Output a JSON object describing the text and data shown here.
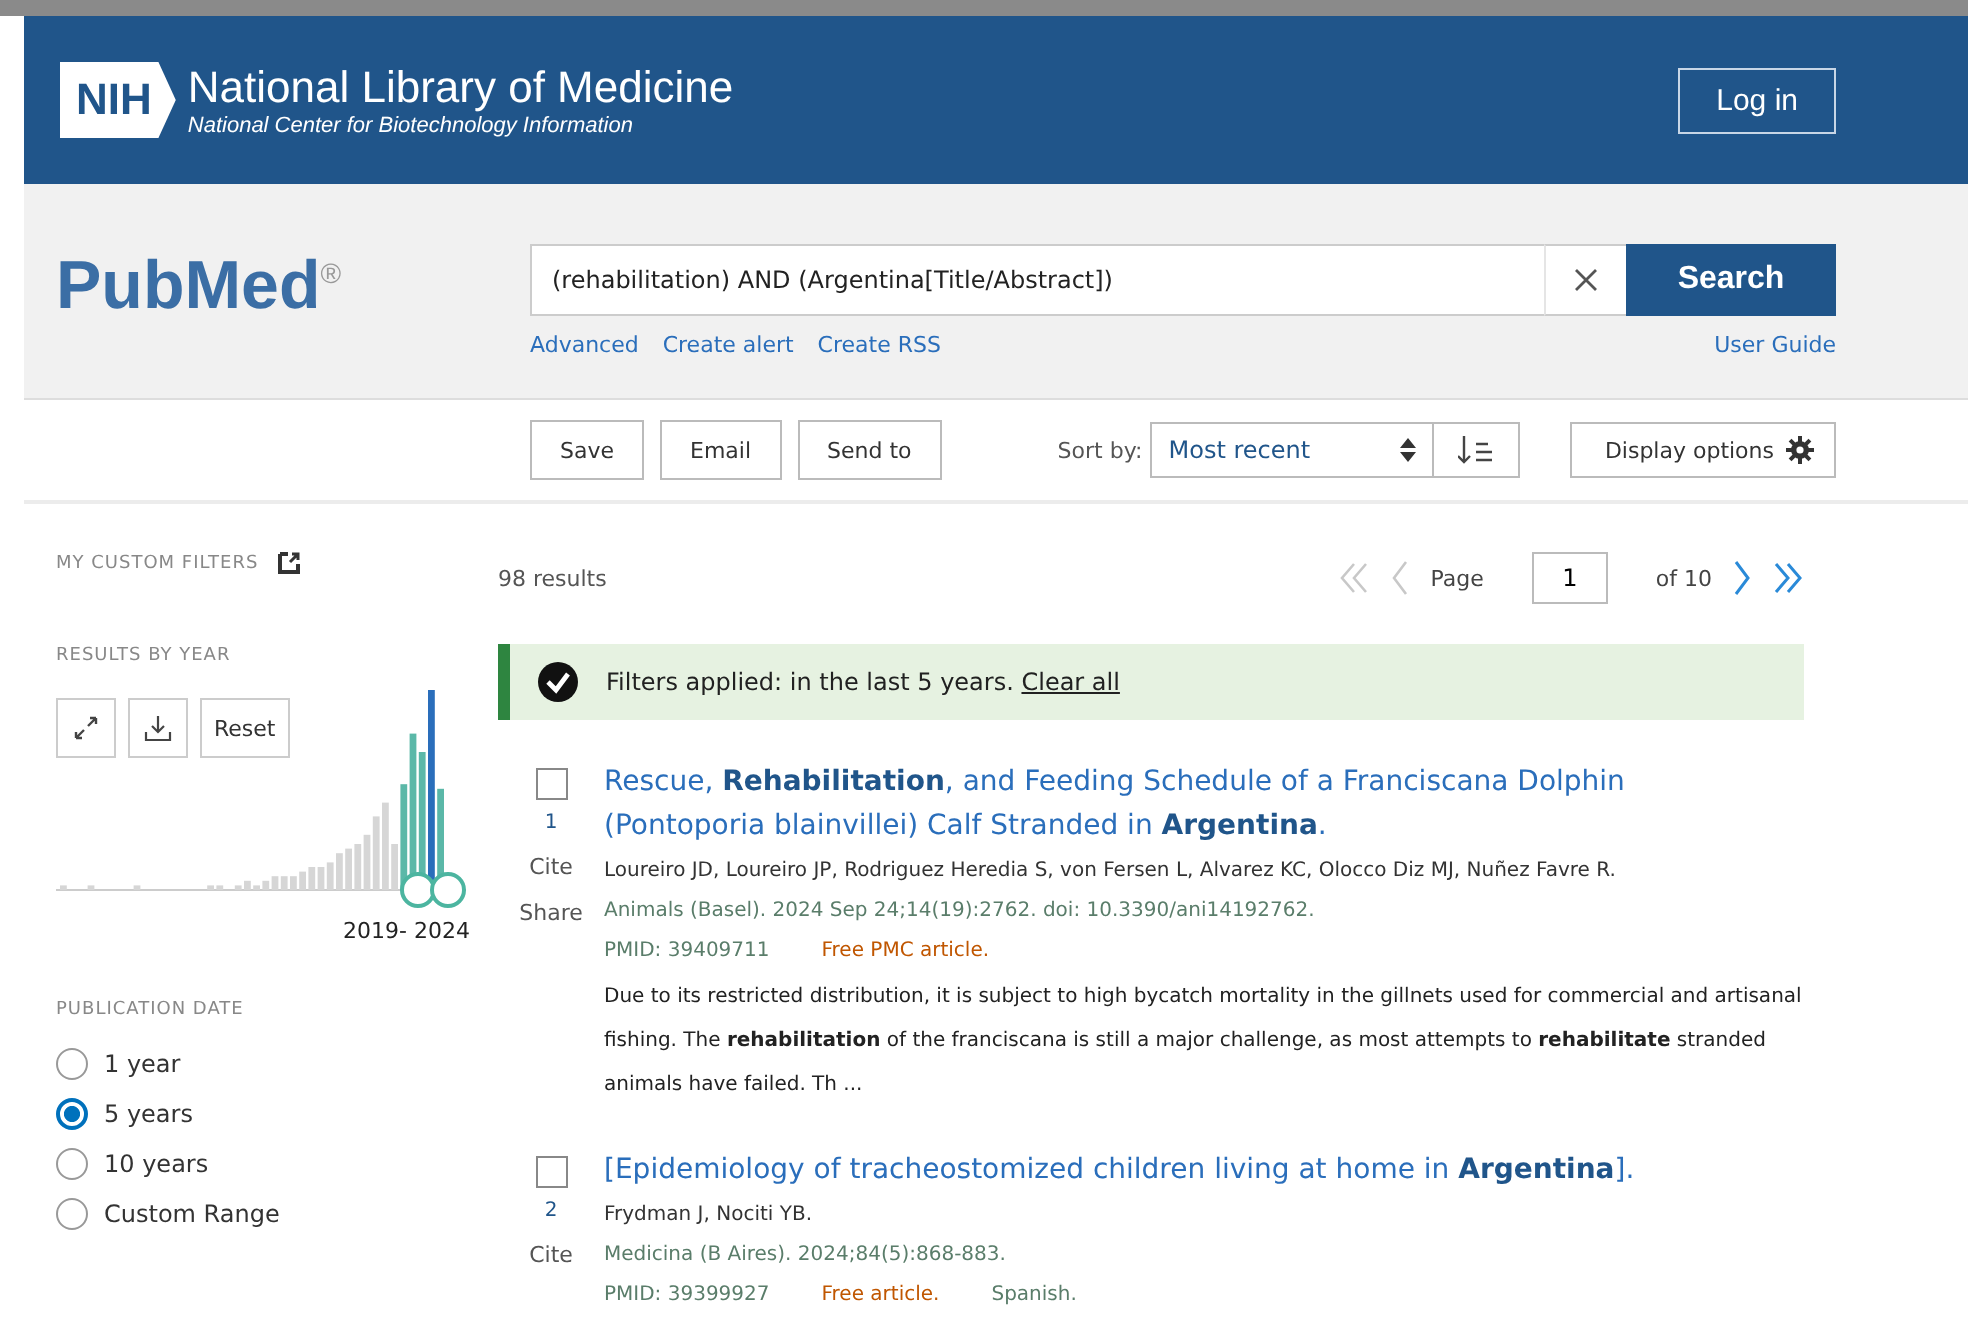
{
  "header": {
    "logo_text": "NIH",
    "title": "National Library of Medicine",
    "subtitle": "National Center for Biotechnology Information",
    "login": "Log in"
  },
  "search": {
    "logo": "PubMed$^{®}$",
    "value": "(rehabilitation) AND (Argentina[Title/Abstract])",
    "button": "Search",
    "links": [
      "Advanced",
      "Create alert",
      "Create RSS"
    ],
    "user_guide": "User Guide"
  },
  "toolbar": {
    "actions": [
      "Save",
      "Email",
      "Send to"
    ],
    "sort_label": "Sort by:",
    "sort_value": "Most recent",
    "display_options": "Display options"
  },
  "sidebar": {
    "custom_filters": "MY CUSTOM FILTERS",
    "results_by_year": "RESULTS BY YEAR",
    "reset": "Reset",
    "range_label": "2019- 2024",
    "publication_date": "PUBLICATION DATE",
    "date_options": [
      {
        "label": "1 year",
        "selected": false
      },
      {
        "label": "5 years",
        "selected": true
      },
      {
        "label": "10 years",
        "selected": false
      },
      {
        "label": "Custom Range",
        "selected": false
      }
    ]
  },
  "results": {
    "count": "98 results",
    "pager": {
      "page_label": "Page",
      "page": "1",
      "of": "of 10"
    },
    "filter_banner": {
      "text": "Filters applied: in the last 5 years.",
      "clear": "Clear all"
    },
    "items": [
      {
        "number": "1",
        "checked": false,
        "title": "Rescue, **Rehabilitation**, and Feeding Schedule of a Franciscana Dolphin (Pontoporia blainvillei) Calf Stranded in **Argentina**.",
        "authors": "Loureiro JD, Loureiro JP, Rodriguez Heredia S, von Fersen L, Alvarez KC, Olocco Diz MJ, Nuñez Favre R.",
        "citation": "Animals (Basel). 2024 Sep 24;14(19):2762. doi: 10.3390/ani14192762.",
        "pmid": "PMID: 39409711",
        "access": "Free PMC article.",
        "snippet": "Due to its restricted distribution, it is subject to high bycatch mortality in the gillnets used for commercial and artisanal fishing. The **rehabilitation** of the franciscana is still a major challenge, as most attempts to **rehabilitate** stranded animals have failed. Th ...",
        "actions": [
          "Cite",
          "Share"
        ]
      },
      {
        "number": "2",
        "checked": false,
        "title": "[Epidemiology of tracheostomized children living at home in **Argentina**].",
        "authors": "Frydman J, Nociti YB.",
        "citation": "Medicina (B Aires). 2024;84(5):868-883.",
        "pmid": "PMID: 39399927",
        "access": "Free article.",
        "language": "Spanish.",
        "actions": [
          "Cite"
        ]
      }
    ]
  }
}
